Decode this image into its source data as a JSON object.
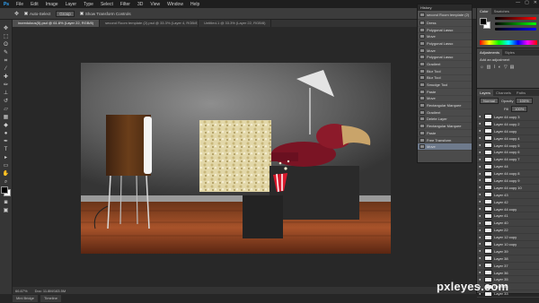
{
  "menu": [
    "File",
    "Edit",
    "Image",
    "Layer",
    "Type",
    "Select",
    "Filter",
    "3D",
    "View",
    "Window",
    "Help"
  ],
  "logo": "Ps",
  "window_controls": [
    "—",
    "▢",
    "✕"
  ],
  "options": {
    "auto_select": "Auto-Select",
    "auto_select_target": "Group",
    "show_transform": "Show Transform Controls"
  },
  "doc_tabs": [
    "incredulous(5).psd @ 61.8% (Layer 22, RGB/8)",
    "second Room template (2).psd @ 33.3% (Layer 4, RGB/8)",
    "Untitled-1 @ 33.3% (Layer 22, RGB/8)"
  ],
  "status": {
    "zoom": "66.67%",
    "doc": "Doc: 11.8M/163.5M"
  },
  "bottom_tabs": [
    "Mini Bridge",
    "Timeline"
  ],
  "history": {
    "title": "History",
    "snapshot": "second Room template (2)",
    "items": [
      "Dress",
      "Polygonal Lasso",
      "Move",
      "Polygonal Lasso",
      "Move",
      "Polygonal Lasso",
      "Gradient",
      "Blur Tool",
      "Blur Tool",
      "Smudge Tool",
      "Paste",
      "Move",
      "Rectangular Marquee",
      "Gradient",
      "Delete Layer",
      "Rectangular Marquee",
      "Paste",
      "Free Transform",
      "Move"
    ]
  },
  "color_panel": {
    "tabs": [
      "Color",
      "Swatches"
    ]
  },
  "adjustments": {
    "tabs": [
      "Adjustments",
      "Styles"
    ],
    "label": "Add an adjustment"
  },
  "layers": {
    "tabs": [
      "Layers",
      "Channels",
      "Paths"
    ],
    "kind": "Normal",
    "opacity_label": "Opacity",
    "opacity": "100%",
    "fill_label": "Fill",
    "fill": "100%",
    "items": [
      "Layer 44 copy 3",
      "Layer 44 copy 2",
      "Layer 44 copy",
      "Layer 44 copy 4",
      "Layer 44 copy 5",
      "Layer 44 copy 6",
      "Layer 44 copy 7",
      "Layer 44",
      "Layer 44 copy 8",
      "Layer 44 copy 9",
      "Layer 44 copy 10",
      "Layer 43",
      "Layer 42",
      "Layer 44 copy",
      "Layer 41",
      "Layer 40",
      "Layer 22",
      "Layer 12 copy",
      "Layer 10 copy",
      "Layer 39",
      "Layer 38",
      "Layer 37",
      "Layer 36",
      "Layer 35",
      "Layer 34",
      "Layer 33"
    ]
  },
  "watermark": "pxleyes.com"
}
